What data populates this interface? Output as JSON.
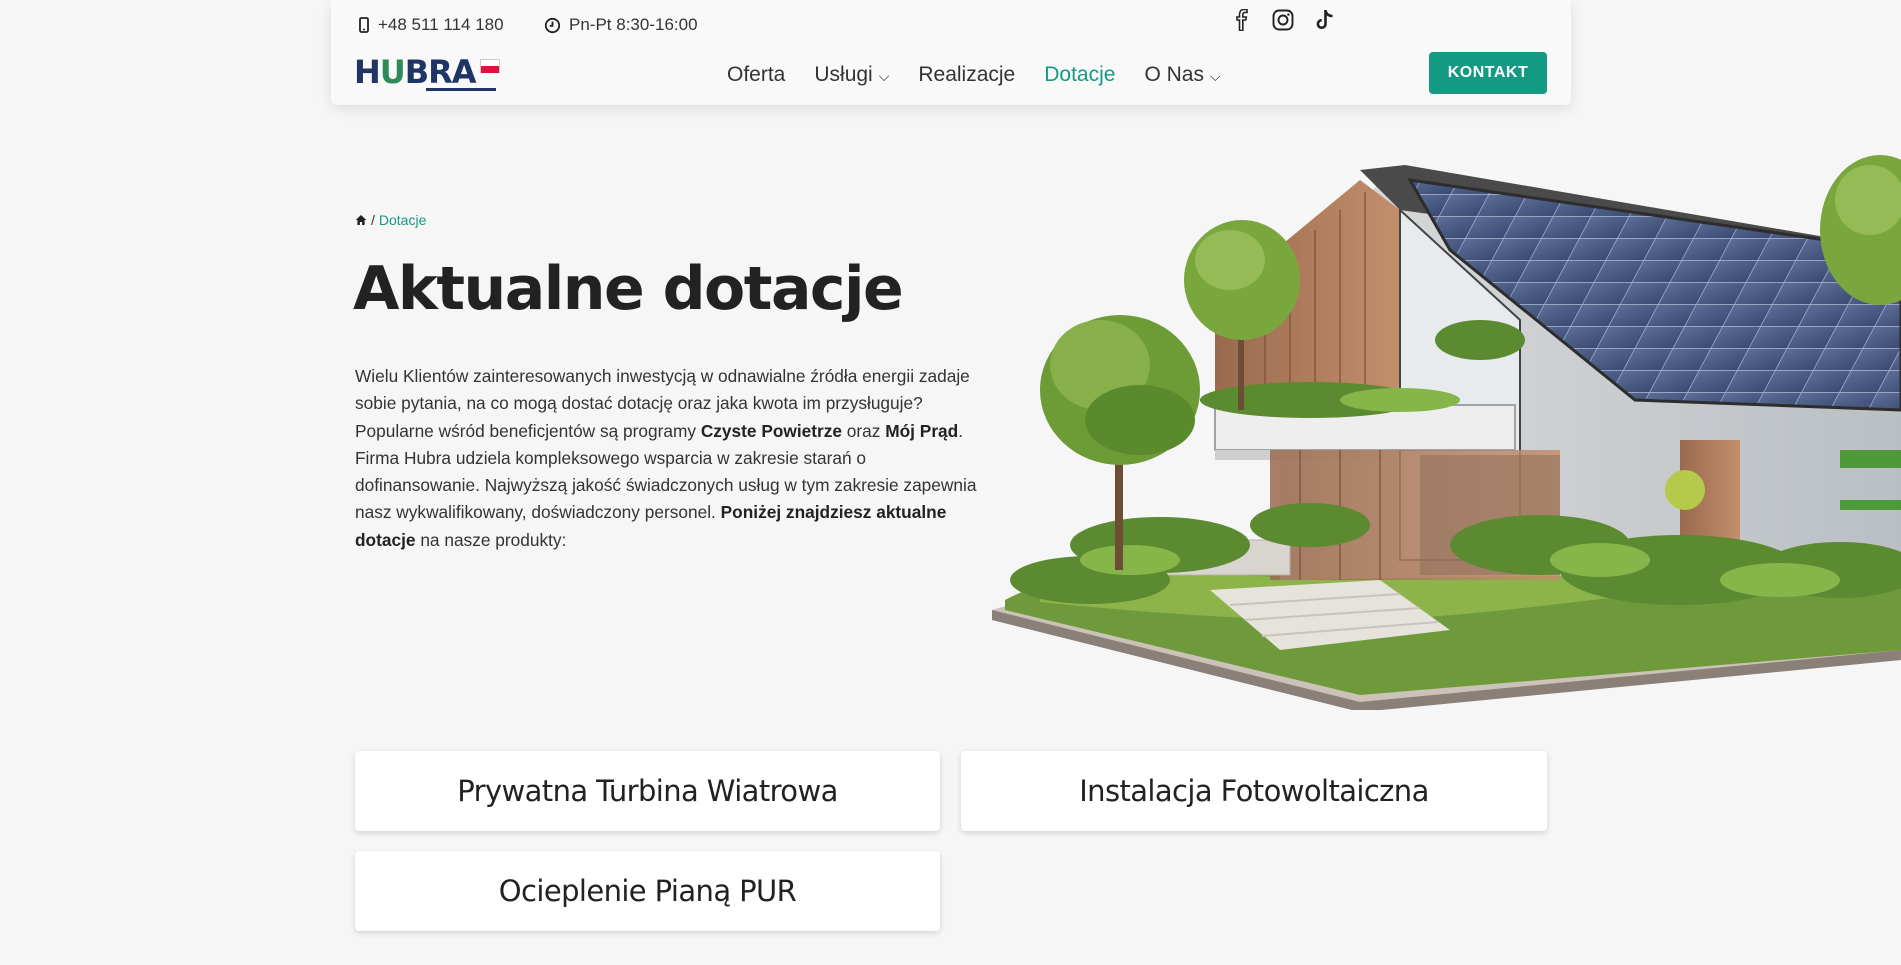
{
  "topbar": {
    "phone": "+48 511 114 180",
    "hours": "Pn-Pt 8:30-16:00",
    "social": [
      "facebook-icon",
      "instagram-icon",
      "tiktok-icon"
    ]
  },
  "logo": {
    "text_h": "H",
    "text_u": "U",
    "text_rest": "BRA"
  },
  "nav": {
    "items": [
      {
        "label": "Oferta",
        "dropdown": false
      },
      {
        "label": "Usługi",
        "dropdown": true
      },
      {
        "label": "Realizacje",
        "dropdown": false
      },
      {
        "label": "Dotacje",
        "dropdown": false,
        "active": true
      },
      {
        "label": "O Nas",
        "dropdown": true
      }
    ],
    "cta": "KONTAKT"
  },
  "colors": {
    "accent": "#149a82",
    "logo_blue": "#1f3566"
  },
  "breadcrumb": {
    "separator": "/",
    "current": "Dotacje"
  },
  "hero": {
    "title": "Aktualne dotacje",
    "p1": "Wielu Klientów zainteresowanych inwestycją w odnawialne źródła energii zadaje sobie pytania, na co mogą dostać dotację oraz jaka kwota im przysługuje? Popularne wśród beneficjentów są programy ",
    "b1": "Czyste Powietrze",
    "p2": " oraz ",
    "b2": "Mój Prąd",
    "p3": ". Firma Hubra udziela kompleksowego wsparcia w zakresie starań o dofinansowanie. Najwyższą jakość świadczonych usług w tym zakresie zapewnia nasz wykwalifikowany, doświadczony personel. ",
    "b3": "Poniżej znajdziesz aktualne dotacje",
    "p4": " na nasze produkty:"
  },
  "cards": [
    "Prywatna Turbina Wiatrowa",
    "Instalacja Fotowoltaiczna",
    "Ocieplenie Pianą PUR"
  ]
}
